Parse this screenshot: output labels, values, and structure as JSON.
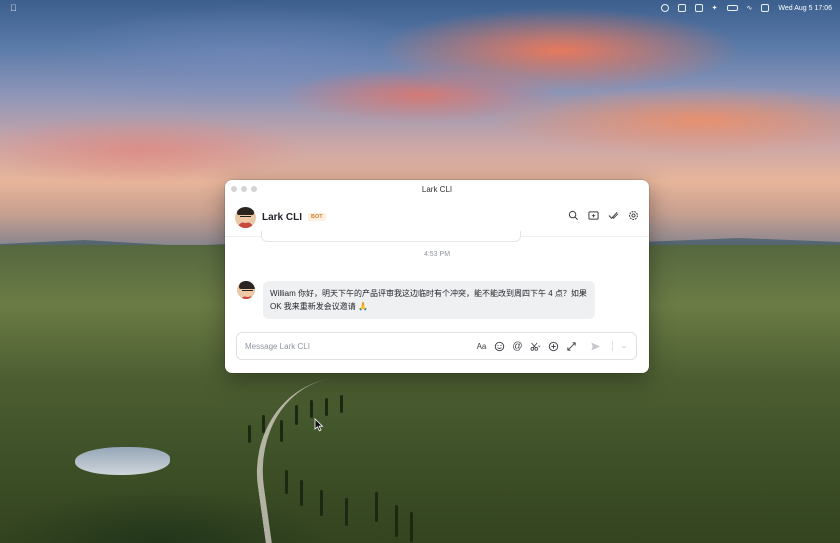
{
  "menubar": {
    "clock": "Wed Aug 5  17:06",
    "icons": [
      "apple-icon",
      "cloud-icon",
      "upload-icon",
      "lark-icon",
      "bluetooth-icon",
      "battery-icon",
      "wifi-icon",
      "control-center-icon"
    ]
  },
  "window": {
    "title": "Lark CLI"
  },
  "chat": {
    "name": "Lark CLI",
    "badge": "BOT",
    "header_icons": [
      "search-icon",
      "add-tab-icon",
      "tasks-check-icon",
      "settings-icon"
    ],
    "time_divider": "4:53 PM",
    "message_text": "William 你好，明天下午的产品评审我这边临时有个冲突，能不能改到周四下午 4 点？如果 OK 我来重新发会议邀请 🙏"
  },
  "composer": {
    "placeholder": "Message Lark CLI",
    "tools": [
      "text-format-icon",
      "emoji-icon",
      "mention-icon",
      "scissors-icon",
      "add-icon",
      "expand-icon",
      "send-icon",
      "send-options-icon"
    ]
  },
  "colors": {
    "accent_bot": "#d7832a",
    "bubble_bg": "#eff0f1"
  }
}
